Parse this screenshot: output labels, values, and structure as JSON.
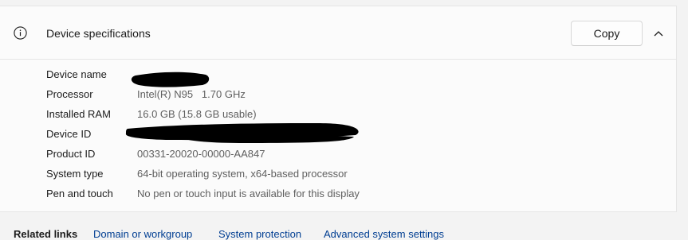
{
  "header": {
    "title": "Device specifications",
    "copy_label": "Copy"
  },
  "specs": [
    {
      "label": "Device name",
      "value": ""
    },
    {
      "label": "Processor",
      "value": "Intel(R) N95   1.70 GHz"
    },
    {
      "label": "Installed RAM",
      "value": "16.0 GB (15.8 GB usable)"
    },
    {
      "label": "Device ID",
      "value": ""
    },
    {
      "label": "Product ID",
      "value": "00331-20020-00000-AA847"
    },
    {
      "label": "System type",
      "value": "64-bit operating system, x64-based processor"
    },
    {
      "label": "Pen and touch",
      "value": "No pen or touch input is available for this display"
    }
  ],
  "related": {
    "label": "Related links",
    "links": [
      "Domain or workgroup",
      "System protection",
      "Advanced system settings"
    ]
  },
  "colors": {
    "link": "#003e92",
    "value_text": "#5f5f5f",
    "redaction": "#000000"
  }
}
